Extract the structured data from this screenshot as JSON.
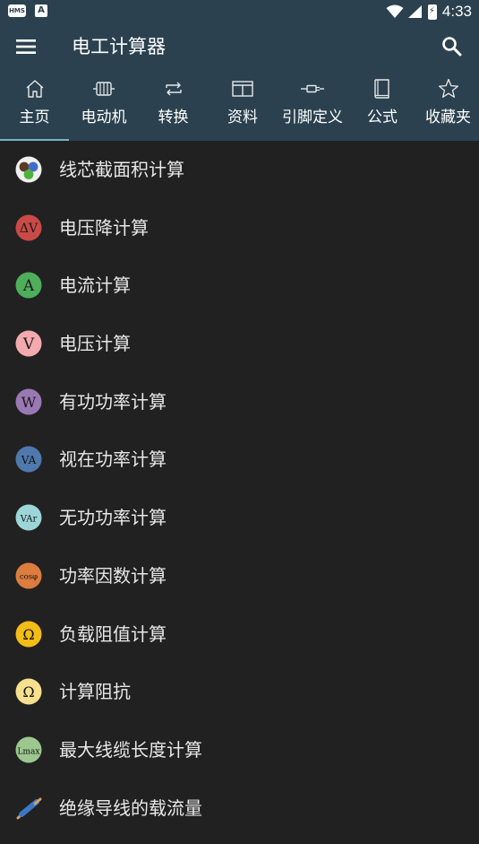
{
  "status_bar": {
    "left_badge_1": "HMS",
    "left_badge_2": "A",
    "battery_glyph": "⚡",
    "time": "4:33"
  },
  "toolbar": {
    "title": "电工计算器",
    "menu_icon": "hamburger-menu-icon",
    "search_icon": "search-icon"
  },
  "tabs": [
    {
      "label": "主页",
      "icon": "home-icon"
    },
    {
      "label": "电动机",
      "icon": "motor-icon"
    },
    {
      "label": "转换",
      "icon": "repeat-icon"
    },
    {
      "label": "资料",
      "icon": "table-icon"
    },
    {
      "label": "引脚定义",
      "icon": "connector-icon"
    },
    {
      "label": "公式",
      "icon": "book-icon"
    },
    {
      "label": "收藏夹",
      "icon": "star-icon"
    }
  ],
  "colors": {
    "header_bg": "#2b414f",
    "body_bg": "#212121",
    "tab_indicator": "#6fb7c6"
  },
  "list": [
    {
      "label": "线芯截面积计算",
      "icon": "wire-cores-icon",
      "glyph": ""
    },
    {
      "label": "电压降计算",
      "icon": "voltage-drop-icon",
      "glyph": "ΔV",
      "color": "#c94a46"
    },
    {
      "label": "电流计算",
      "icon": "current-icon",
      "glyph": "A",
      "color": "#4fae5b"
    },
    {
      "label": "电压计算",
      "icon": "voltage-icon",
      "glyph": "V",
      "color": "#f3aaae"
    },
    {
      "label": "有功功率计算",
      "icon": "active-power-icon",
      "glyph": "W",
      "color": "#9a78b4"
    },
    {
      "label": "视在功率计算",
      "icon": "apparent-power-icon",
      "glyph": "VA",
      "color": "#4f79ad"
    },
    {
      "label": "无功功率计算",
      "icon": "reactive-power-icon",
      "glyph": "VAr",
      "color": "#9cd6d8"
    },
    {
      "label": "功率因数计算",
      "icon": "power-factor-icon",
      "glyph": "cosφ",
      "color": "#dd7c3f"
    },
    {
      "label": "负载阻值计算",
      "icon": "load-resistance-icon",
      "glyph": "Ω",
      "color": "#f2bc19"
    },
    {
      "label": "计算阻抗",
      "icon": "impedance-icon",
      "glyph": "Ω",
      "color": "#f6e08e"
    },
    {
      "label": "最大线缆长度计算",
      "icon": "max-cable-length-icon",
      "glyph": "Lmax",
      "color": "#9cc78f"
    },
    {
      "label": "绝缘导线的载流量",
      "icon": "insulated-wire-icon",
      "glyph": ""
    }
  ]
}
